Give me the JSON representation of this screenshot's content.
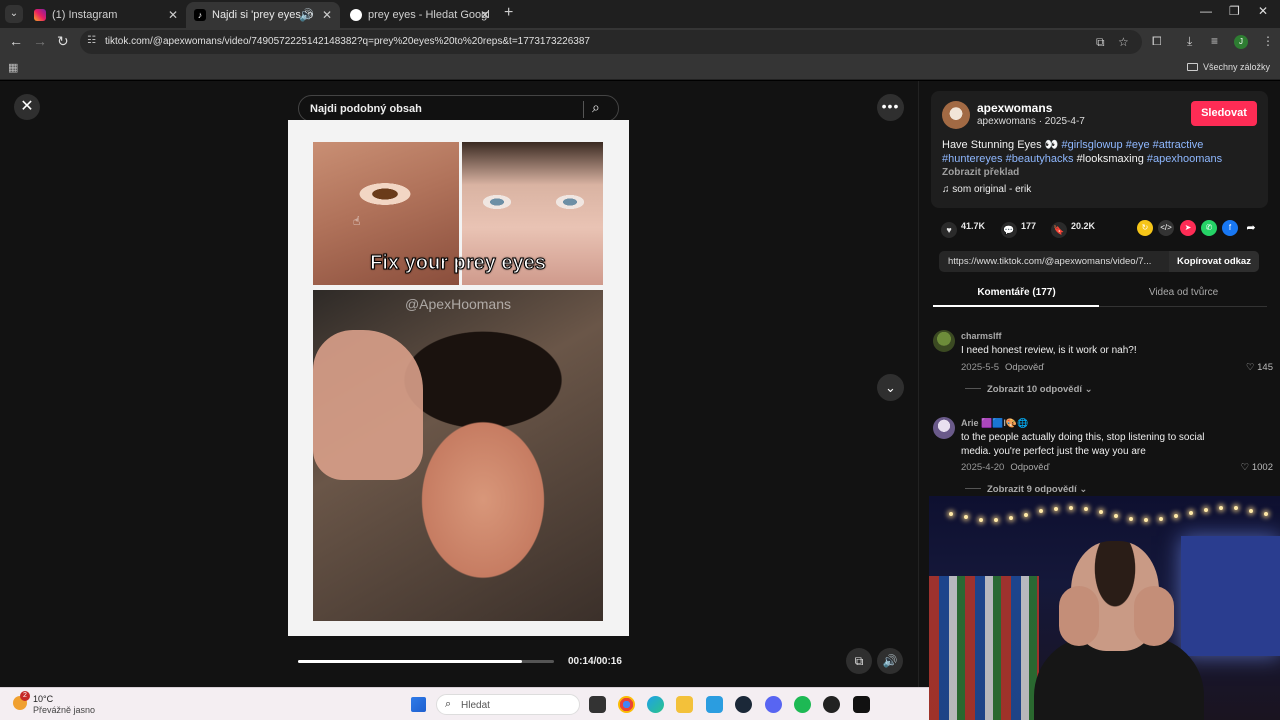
{
  "browser": {
    "tabs": [
      {
        "title": "(1) Instagram",
        "active": false
      },
      {
        "title": "Najdi si 'prey eyes to reps' ...",
        "active": true
      },
      {
        "title": "prey eyes - Hledat Googlem",
        "active": false
      }
    ],
    "url": "tiktok.com/@apexwomans/video/7490572225142148382?q=prey%20eyes%20to%20reps&t=1773173226387",
    "bookmarks_label": "Všechny záložky",
    "profile_initial": "J"
  },
  "video": {
    "search_label": "Najdi podobný obsah",
    "caption": "Fix your prey eyes",
    "watermark": "@ApexHoomans",
    "time": "00:14/00:16",
    "progress": 0.875
  },
  "post": {
    "author": "apexwomans",
    "author_sub": "apexwomans · 2025-4-7",
    "follow_label": "Sledovat",
    "description_plain": "Have Stunning Eyes 👀",
    "tags": [
      "#girlsglowup",
      "#eye",
      "#attractive",
      "#huntereyes",
      "#beautyhacks"
    ],
    "plain_tag": "#looksmaxing",
    "last_tag": "#apexhoomans",
    "translate_label": "Zobrazit překlad",
    "music": "som original - erik",
    "likes": "41.7K",
    "comments": "177",
    "saves": "20.2K",
    "share_link": "https://www.tiktok.com/@apexwomans/video/7...",
    "copy_label": "Kopírovat odkaz"
  },
  "comment_tabs": {
    "comments": "Komentáře (177)",
    "creator_videos": "Videa od tvůrce"
  },
  "comments": [
    {
      "user": "charmslff",
      "text": "I need honest review, is it work or nah?!",
      "date": "2025-5-5",
      "reply_label": "Odpověď",
      "likes": "145",
      "replies": "Zobrazit 10 odpovědí"
    },
    {
      "user": "Arie 🟪🟦I🎨🌐",
      "text": "to the people actually doing this, stop listening to social media. you're perfect just the way you are",
      "date": "2025-4-20",
      "reply_label": "Odpověď",
      "likes": "1002",
      "replies": "Zobrazit 9 odpovědí"
    }
  ],
  "taskbar": {
    "temperature": "10°C",
    "condition": "Převážně jasno",
    "search_placeholder": "Hledat",
    "weather_badge": "2"
  },
  "colors": {
    "accent": "#fe2c55",
    "hashtag": "#8fb8ff",
    "panel": "#121212"
  }
}
